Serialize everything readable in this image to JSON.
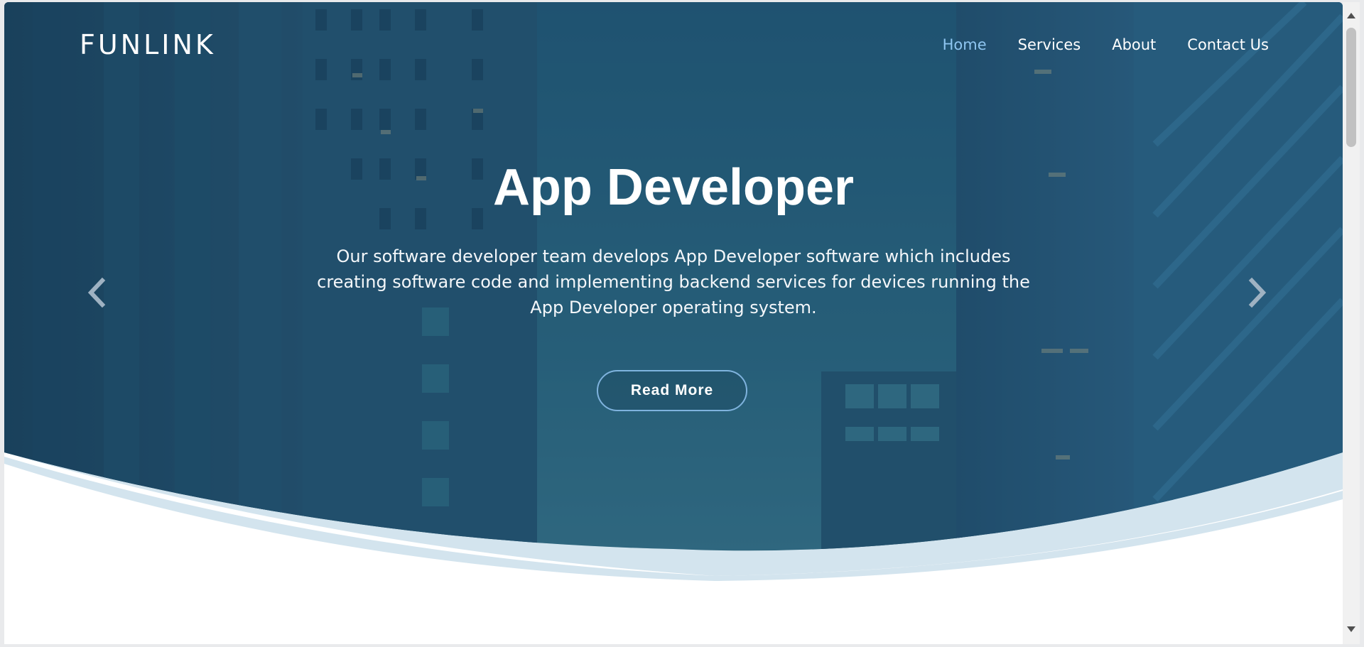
{
  "brand": {
    "logo": "FUNLINK"
  },
  "nav": {
    "items": [
      {
        "label": "Home",
        "active": true
      },
      {
        "label": "Services",
        "active": false
      },
      {
        "label": "About",
        "active": false
      },
      {
        "label": "Contact Us",
        "active": false
      }
    ]
  },
  "hero": {
    "title": "App Developer",
    "description": "Our software developer team develops App Developer software which includes creating software code and implementing backend services for devices running the App Developer operating system.",
    "cta_label": "Read More",
    "prev_icon": "chevron-left-icon",
    "next_icon": "chevron-right-icon"
  },
  "colors": {
    "overlay": "#1f4f6f",
    "nav_active": "#8ec5f0",
    "wave": "#d3e4ee",
    "button_border": "#7fb3de"
  }
}
